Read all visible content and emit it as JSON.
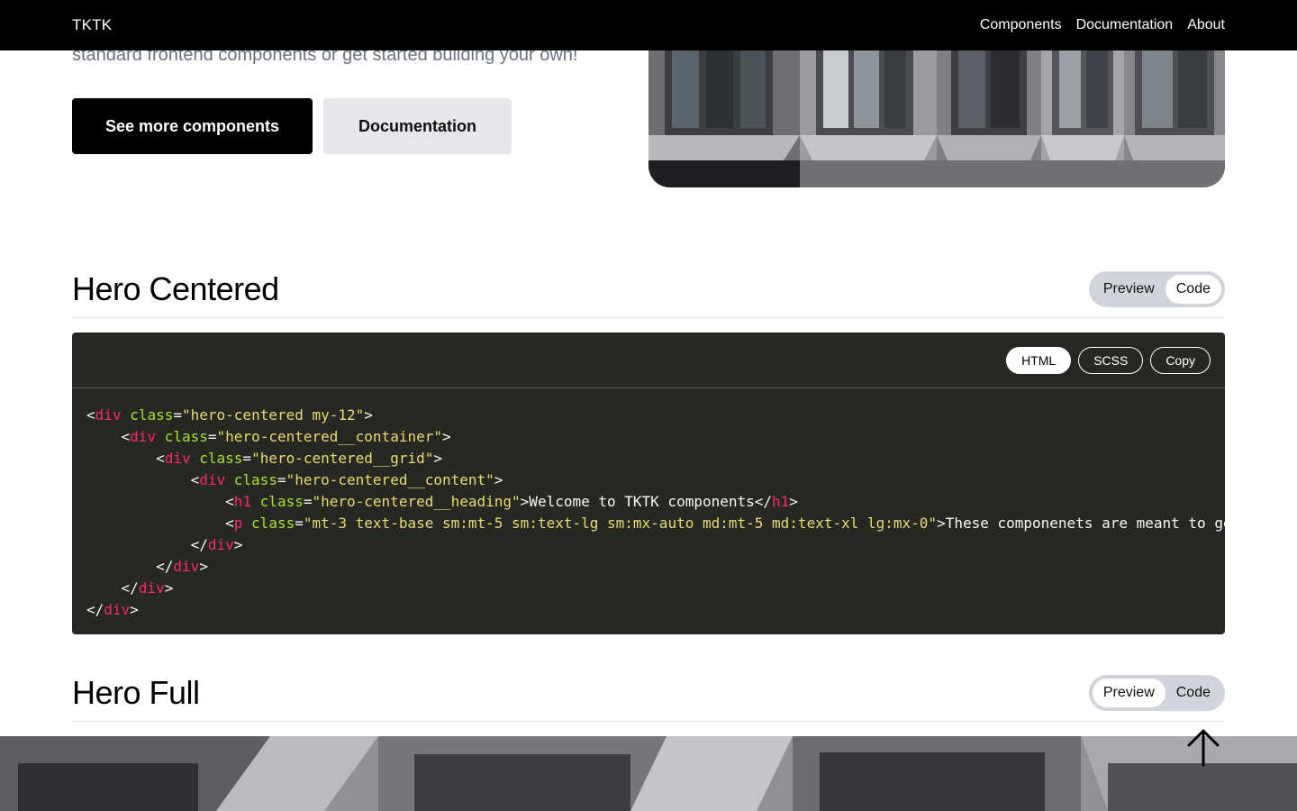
{
  "nav": {
    "brand": "TKTK",
    "links": [
      "Components",
      "Documentation",
      "About"
    ]
  },
  "hero_top": {
    "text_tail": "standard frontend components or get started building your own!",
    "primary_button": "See more components",
    "secondary_button": "Documentation"
  },
  "sections": [
    {
      "title": "Hero Centered",
      "toggle": {
        "preview": "Preview",
        "code": "Code",
        "active": "Code"
      }
    },
    {
      "title": "Hero Full",
      "toggle": {
        "preview": "Preview",
        "code": "Code",
        "active": "Preview"
      }
    }
  ],
  "code_panel": {
    "tabs": [
      "HTML",
      "SCSS"
    ],
    "active_tab": "HTML",
    "copy_label": "Copy",
    "lines": [
      [
        [
          "p",
          "<"
        ],
        [
          "t",
          "div"
        ],
        [
          "p",
          " "
        ],
        [
          "a",
          "class"
        ],
        [
          "p",
          "="
        ],
        [
          "s",
          "\"hero-centered my-12\""
        ],
        [
          "p",
          ">"
        ]
      ],
      [
        [
          "p",
          "    <"
        ],
        [
          "t",
          "div"
        ],
        [
          "p",
          " "
        ],
        [
          "a",
          "class"
        ],
        [
          "p",
          "="
        ],
        [
          "s",
          "\"hero-centered__container\""
        ],
        [
          "p",
          ">"
        ]
      ],
      [
        [
          "p",
          "        <"
        ],
        [
          "t",
          "div"
        ],
        [
          "p",
          " "
        ],
        [
          "a",
          "class"
        ],
        [
          "p",
          "="
        ],
        [
          "s",
          "\"hero-centered__grid\""
        ],
        [
          "p",
          ">"
        ]
      ],
      [
        [
          "p",
          "            <"
        ],
        [
          "t",
          "div"
        ],
        [
          "p",
          " "
        ],
        [
          "a",
          "class"
        ],
        [
          "p",
          "="
        ],
        [
          "s",
          "\"hero-centered__content\""
        ],
        [
          "p",
          ">"
        ]
      ],
      [
        [
          "p",
          "                <"
        ],
        [
          "t",
          "h1"
        ],
        [
          "p",
          " "
        ],
        [
          "a",
          "class"
        ],
        [
          "p",
          "="
        ],
        [
          "s",
          "\"hero-centered__heading\""
        ],
        [
          "p",
          ">Welcome to TKTK components</"
        ],
        [
          "t",
          "h1"
        ],
        [
          "p",
          ">"
        ]
      ],
      [
        [
          "p",
          "                <"
        ],
        [
          "t",
          "p"
        ],
        [
          "p",
          " "
        ],
        [
          "a",
          "class"
        ],
        [
          "p",
          "="
        ],
        [
          "s",
          "\"mt-3 text-base sm:mt-5 sm:text-lg sm:mx-auto md:mt-5 md:text-xl lg:mx-0\""
        ],
        [
          "p",
          ">These componenets are meant to get you started with standard frontend components"
        ]
      ],
      [
        [
          "p",
          "            </"
        ],
        [
          "t",
          "div"
        ],
        [
          "p",
          ">"
        ]
      ],
      [
        [
          "p",
          "        </"
        ],
        [
          "t",
          "div"
        ],
        [
          "p",
          ">"
        ]
      ],
      [
        [
          "p",
          "    </"
        ],
        [
          "t",
          "div"
        ],
        [
          "p",
          ">"
        ]
      ],
      [
        [
          "p",
          "</"
        ],
        [
          "t",
          "div"
        ],
        [
          "p",
          ">"
        ]
      ]
    ]
  },
  "colors": {
    "nav_bg": "#000000",
    "code_bg": "#272822",
    "tag": "#f92672",
    "attr": "#a6e22e",
    "string": "#e6db74",
    "toggle_bg": "#d1d5db"
  },
  "icons": {
    "scroll_top": "arrow-up-icon"
  }
}
